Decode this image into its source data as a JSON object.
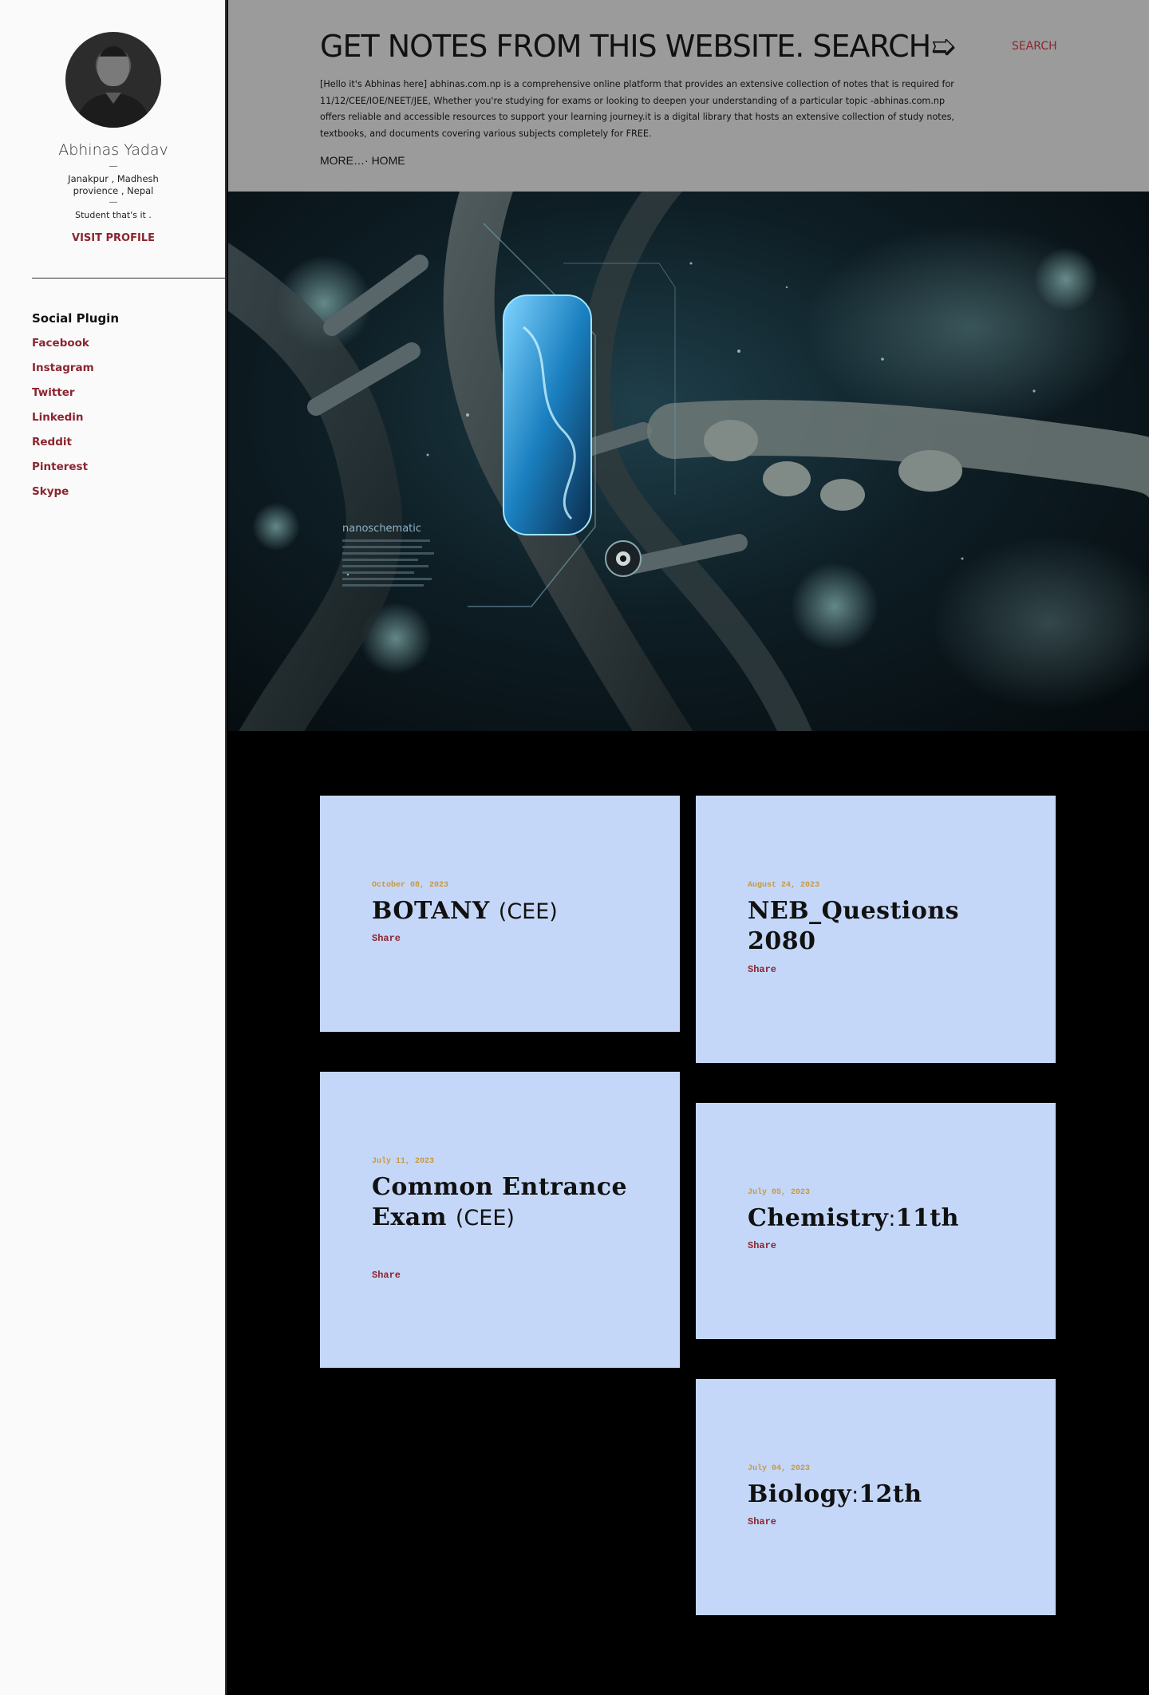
{
  "sidebar": {
    "author_name": "Abhinas Yadav",
    "separator": "—",
    "location": "Janakpur , Madhesh provience , Nepal",
    "bio": "Student that's it .",
    "visit_profile": "VISIT PROFILE",
    "social_title": "Social Plugin",
    "social_links": [
      "Facebook",
      "Instagram",
      "Twitter",
      "Linkedin",
      "Reddit",
      "Pinterest",
      "Skype"
    ]
  },
  "header": {
    "title": "GET NOTES FROM THIS WEBSITE. SEARCH➯",
    "search_label": "SEARCH",
    "description": "[Hello it's Abhinas here] abhinas.com.np is a comprehensive online platform that provides an extensive collection of notes that is required for 11/12/CEE/IOE/NEET/JEE, Whether you're studying for exams or looking to deepen your understanding of a particular topic -abhinas.com.np offers reliable and accessible resources to support your learning journey.it is a digital library that hosts an extensive collection of study notes, textbooks, and documents covering various subjects completely for FREE.",
    "nav_more": "MORE…",
    "nav_sep": "·",
    "nav_home": "HOME"
  },
  "hero": {
    "caption": "nanoschematic"
  },
  "posts": [
    {
      "date": "October 08, 2023",
      "title_bold": "BOTANY",
      "title_light": "(CEE)",
      "share": "Share"
    },
    {
      "date": "August 24, 2023",
      "title_bold": "NEB_Questions 2080",
      "title_light": "",
      "share": "Share"
    },
    {
      "date": "July 11, 2023",
      "title_bold": "Common Entrance Exam",
      "title_light": "(CEE)",
      "share": "Share"
    },
    {
      "date": "July 05, 2023",
      "title_bold": "Chemistry",
      "title_light": ":",
      "title_bold2": "11th",
      "share": "Share"
    },
    {
      "date": "July 04, 2023",
      "title_bold": "Biology",
      "title_light": ":",
      "title_bold2": "12th",
      "share": "Share"
    }
  ],
  "colors": {
    "accent": "#8b2530",
    "header_bg": "#9b9b9b",
    "card_bg": "#c4d7f8",
    "date_color": "#c9993f"
  }
}
